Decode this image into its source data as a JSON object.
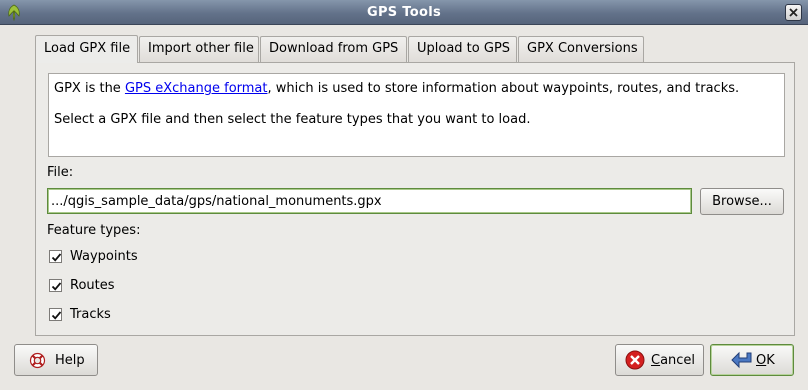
{
  "window": {
    "title": "GPS Tools"
  },
  "tabs": [
    {
      "label": "Load GPX file",
      "active": true
    },
    {
      "label": "Import other file",
      "active": false
    },
    {
      "label": "Download from GPS",
      "active": false
    },
    {
      "label": "Upload to GPS",
      "active": false
    },
    {
      "label": "GPX Conversions",
      "active": false
    }
  ],
  "description": {
    "line1_prefix": "GPX is the ",
    "link_text": "GPS eXchange format",
    "line1_suffix": ", which is used to store information about waypoints, routes, and tracks.",
    "line2": "Select a GPX file and then select the feature types that you want to load."
  },
  "file": {
    "label": "File:",
    "value": ".../qgis_sample_data/gps/national_monuments.gpx",
    "browse_label": "Browse..."
  },
  "feature_types": {
    "label": "Feature types:",
    "items": [
      {
        "label": "Waypoints",
        "checked": true
      },
      {
        "label": "Routes",
        "checked": true
      },
      {
        "label": "Tracks",
        "checked": true
      }
    ]
  },
  "buttons": {
    "help_label": "Help",
    "cancel_mnemonic": "C",
    "cancel_rest": "ancel",
    "ok_mnemonic": "O",
    "ok_rest": "K"
  },
  "icons": {
    "app": "qgis-icon",
    "close": "close-icon",
    "help": "lifebuoy-icon",
    "cancel": "cancel-icon",
    "ok": "ok-arrow-icon"
  },
  "colors": {
    "titlebar": "#63728a",
    "link": "#0000ee",
    "focus_border": "#5e8b3d",
    "cancel_icon": "#d42020",
    "ok_icon": "#4a78c2"
  }
}
